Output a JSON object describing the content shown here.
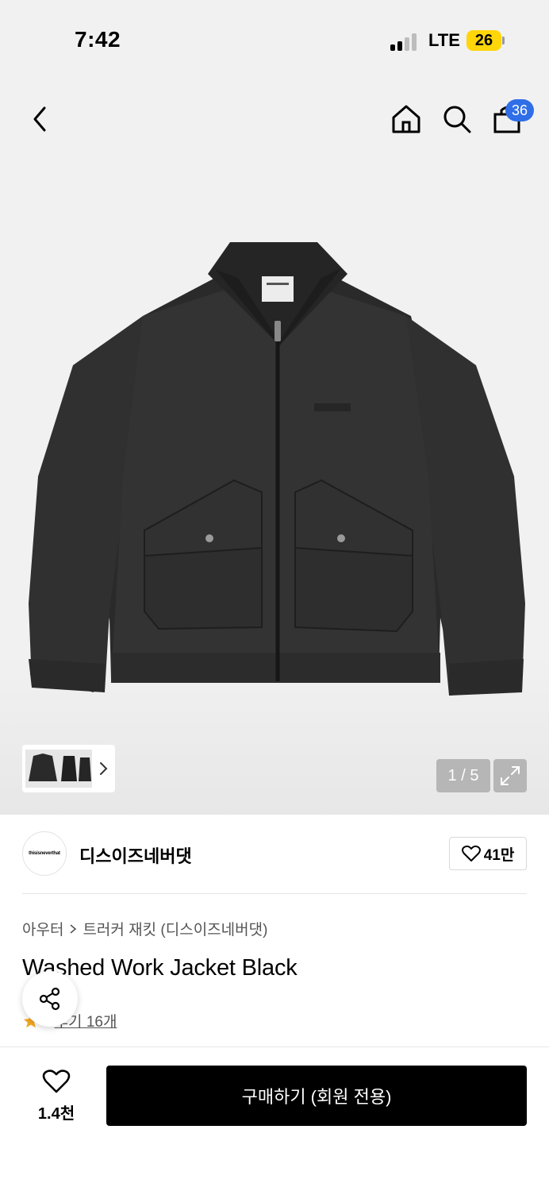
{
  "status_bar": {
    "time": "7:42",
    "network": "LTE",
    "battery": "26"
  },
  "header": {
    "cart_count": "36",
    "icons": [
      "back-icon",
      "home-icon",
      "search-icon",
      "cart-icon"
    ]
  },
  "gallery": {
    "counter": "1 / 5",
    "thumbnail_more_icon": "chevron-right-icon",
    "expand_icon": "expand-icon"
  },
  "brand": {
    "logo_text": "thisisneverthat",
    "name": "디스이즈네버댓",
    "likes": "41만"
  },
  "breadcrumb": {
    "category": "아우터",
    "subcategory": "트러커 재킷 (디스이즈네버댓)"
  },
  "product": {
    "title": "Washed Work Jacket Black",
    "rating": "5",
    "reviews": "후기 16개"
  },
  "bottom_bar": {
    "wish_count": "1.4천",
    "buy_label": "구매하기 (회원 전용)"
  },
  "colors": {
    "accent_badge": "#2f6ee7",
    "star": "#f5a623",
    "buy_button": "#000000",
    "battery": "#ffd60a"
  }
}
